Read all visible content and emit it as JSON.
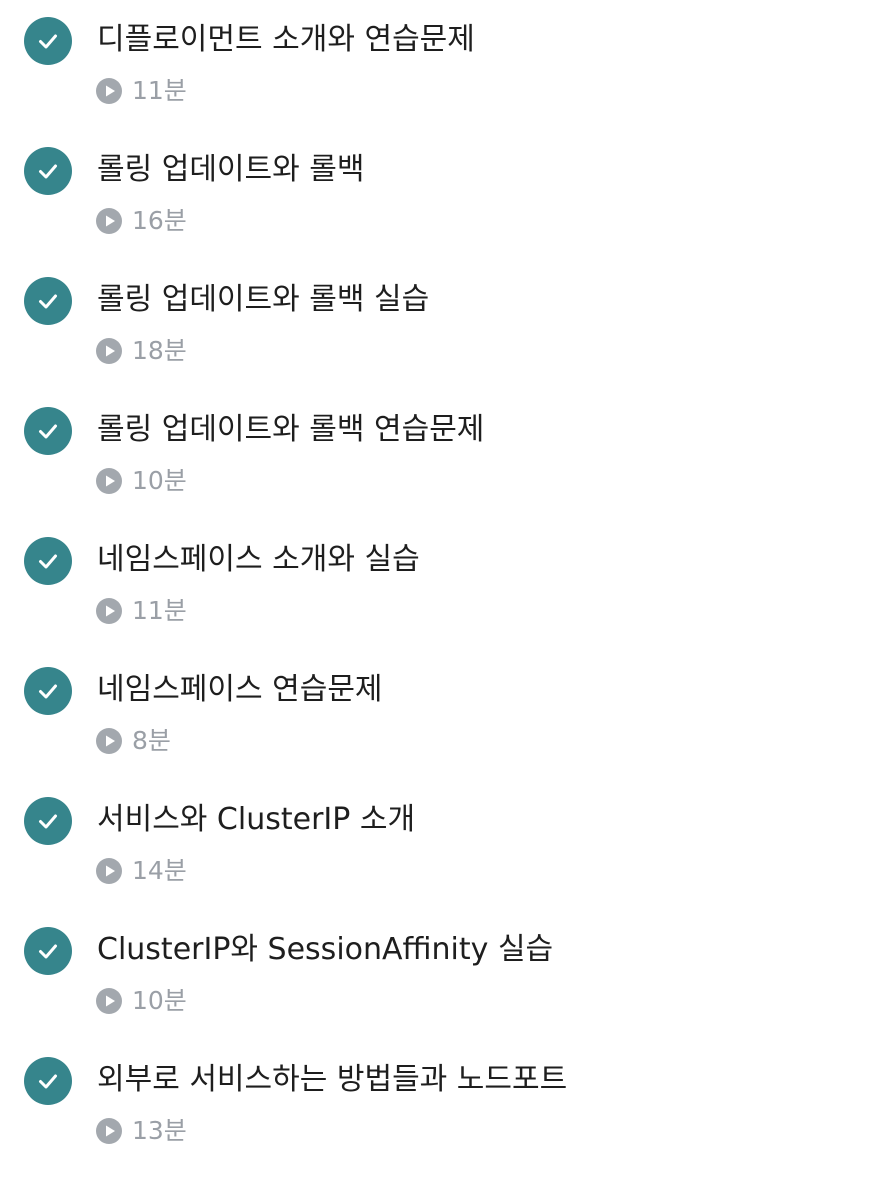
{
  "lessons": [
    {
      "title": "디플로이먼트 소개와 연습문제",
      "duration": "11분",
      "completed": true
    },
    {
      "title": "롤링 업데이트와 롤백",
      "duration": "16분",
      "completed": true
    },
    {
      "title": "롤링 업데이트와 롤백 실습",
      "duration": "18분",
      "completed": true
    },
    {
      "title": "롤링 업데이트와 롤백 연습문제",
      "duration": "10분",
      "completed": true
    },
    {
      "title": "네임스페이스 소개와 실습",
      "duration": "11분",
      "completed": true
    },
    {
      "title": "네임스페이스 연습문제",
      "duration": "8분",
      "completed": true
    },
    {
      "title": "서비스와 ClusterIP 소개",
      "duration": "14분",
      "completed": true
    },
    {
      "title": "ClusterIP와 SessionAffinity 실습",
      "duration": "10분",
      "completed": true
    },
    {
      "title": "외부로 서비스하는 방법들과 노드포트",
      "duration": "13분",
      "completed": true
    }
  ],
  "icons": {
    "completed": "check-circle-icon",
    "duration": "play-circle-icon"
  },
  "colors": {
    "check_circle": "#36858c",
    "title_text": "#1e1e1e",
    "meta_text": "#9a9fa6",
    "play_icon": "#a3a8ae"
  }
}
